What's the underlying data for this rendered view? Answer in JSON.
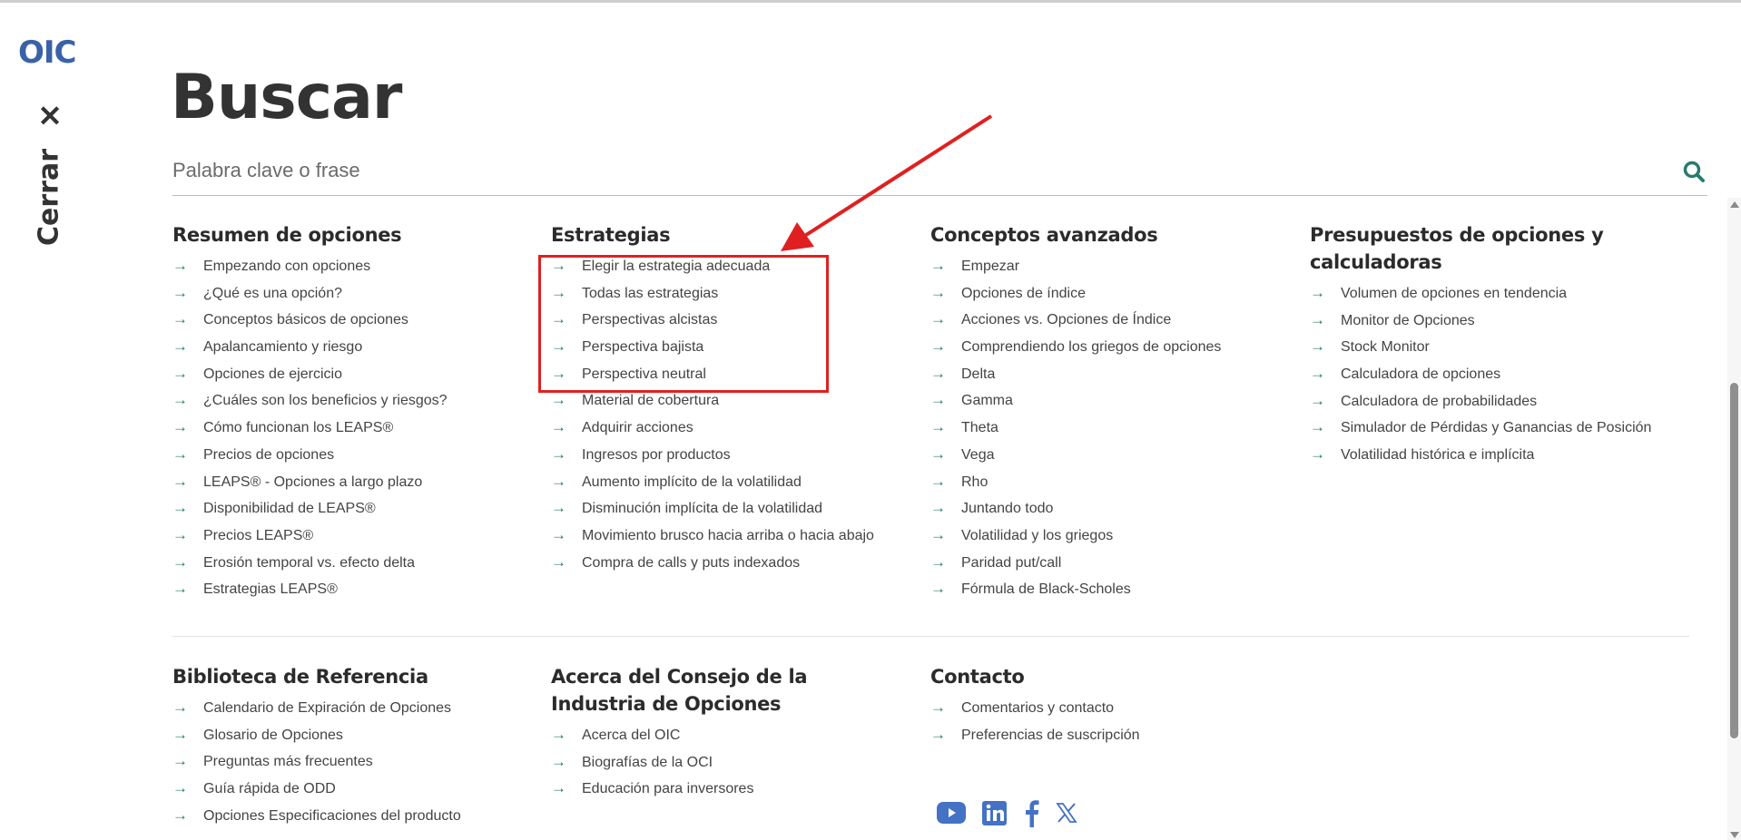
{
  "logo": "OIC",
  "close_label": "Cerrar",
  "title": "Buscar",
  "search": {
    "placeholder": "Palabra clave o frase",
    "value": ""
  },
  "sections": [
    {
      "title": "Resumen de opciones",
      "items": [
        "Empezando con opciones",
        "¿Qué es una opción?",
        "Conceptos básicos de opciones",
        "Apalancamiento y riesgo",
        "Opciones de ejercicio",
        "¿Cuáles son los beneficios y riesgos?",
        "Cómo funcionan los LEAPS®",
        "Precios de opciones",
        "LEAPS® - Opciones a largo plazo",
        "Disponibilidad de LEAPS®",
        "Precios LEAPS®",
        "Erosión temporal vs. efecto delta",
        "Estrategias LEAPS®"
      ]
    },
    {
      "title": "Estrategias",
      "items": [
        "Elegir la estrategia adecuada",
        "Todas las estrategias",
        "Perspectivas alcistas",
        "Perspectiva bajista",
        "Perspectiva neutral",
        "Material de cobertura",
        "Adquirir acciones",
        "Ingresos por productos",
        "Aumento implícito de la volatilidad",
        "Disminución implícita de la volatilidad",
        "Movimiento brusco hacia arriba o hacia abajo",
        "Compra de calls y puts indexados"
      ]
    },
    {
      "title": "Conceptos avanzados",
      "items": [
        "Empezar",
        "Opciones de índice",
        "Acciones vs. Opciones de Índice",
        "Comprendiendo los griegos de opciones",
        "Delta",
        "Gamma",
        "Theta",
        "Vega",
        "Rho",
        "Juntando todo",
        "Volatilidad y los griegos",
        "Paridad put/call",
        "Fórmula de Black-Scholes"
      ]
    },
    {
      "title": "Presupuestos de opciones y calculadoras",
      "items": [
        "Volumen de opciones en tendencia",
        "Monitor de Opciones",
        "Stock Monitor",
        "Calculadora de opciones",
        "Calculadora de probabilidades",
        "Simulador de Pérdidas y Ganancias de Posición",
        "Volatilidad histórica e implícita"
      ]
    },
    {
      "title": "Biblioteca de Referencia",
      "items": [
        "Calendario de Expiración de Opciones",
        "Glosario de Opciones",
        "Preguntas más frecuentes",
        "Guía rápida de ODD",
        "Opciones Especificaciones del producto"
      ]
    },
    {
      "title": "Acerca del Consejo de la Industria de Opciones",
      "items": [
        "Acerca del OIC",
        "Biografías de la OCI",
        "Educación para inversores"
      ]
    },
    {
      "title": "Contacto",
      "items": [
        "Comentarios y contacto",
        "Preferencias de suscripción"
      ]
    }
  ],
  "social": [
    "youtube-icon",
    "linkedin-icon",
    "facebook-icon",
    "x-icon"
  ],
  "colors": {
    "accent": "#2a7a6e",
    "brand": "#3a62a8",
    "annotation": "#e02020",
    "social": "#4472c4"
  }
}
